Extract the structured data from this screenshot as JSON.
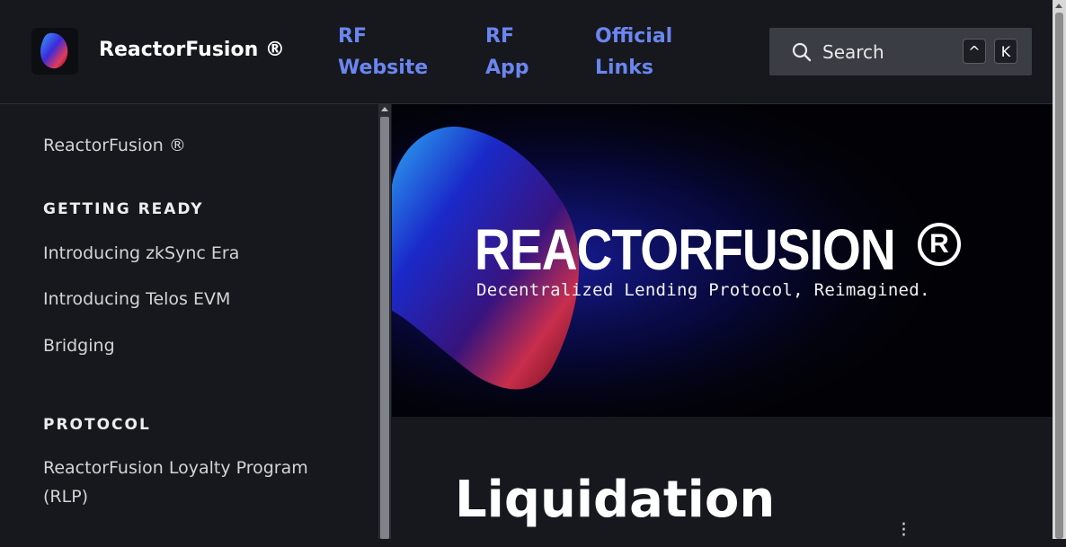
{
  "header": {
    "brand": "ReactorFusion ®",
    "nav": [
      {
        "line1": "RF",
        "line2": "Website"
      },
      {
        "line1": "RF",
        "line2": "App"
      },
      {
        "line1": "Official",
        "line2": "Links"
      }
    ],
    "search": {
      "placeholder": "Search",
      "shortcut_mod": "^",
      "shortcut_key": "K"
    }
  },
  "sidebar": {
    "home": "ReactorFusion ®",
    "sections": [
      {
        "heading": "GETTING READY",
        "items": [
          "Introducing zkSync Era",
          "Introducing Telos EVM",
          "Bridging"
        ]
      },
      {
        "heading": "PROTOCOL",
        "items": [
          "ReactorFusion Loyalty Program (RLP)"
        ]
      }
    ]
  },
  "hero": {
    "title": "REACTORFUSION",
    "reg_mark": "R",
    "subtitle": "Decentralized Lending Protocol, Reimagined."
  },
  "main": {
    "title": "Liquidation"
  },
  "colors": {
    "accent": "#6b86f0",
    "background": "#16181d",
    "hero_bg": "#020206"
  }
}
